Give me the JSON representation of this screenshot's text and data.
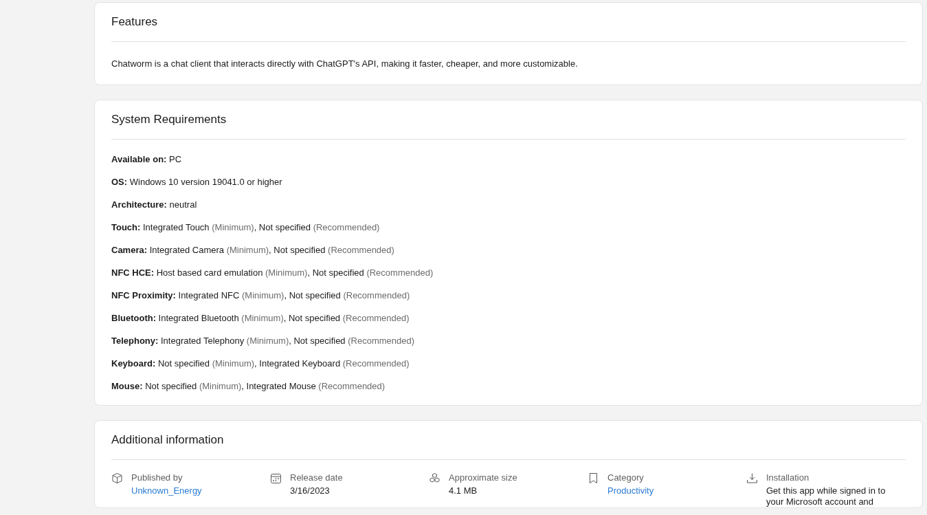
{
  "features": {
    "title": "Features",
    "description": "Chatworm is a chat client that interacts directly with ChatGPT's API, making it faster, cheaper, and more customizable."
  },
  "system_requirements": {
    "title": "System Requirements",
    "items": [
      {
        "label": "Available on:",
        "parts": [
          {
            "text": "PC",
            "muted": false
          }
        ]
      },
      {
        "label": "OS:",
        "parts": [
          {
            "text": "Windows 10 version 19041.0 or higher",
            "muted": false
          }
        ]
      },
      {
        "label": "Architecture:",
        "parts": [
          {
            "text": "neutral",
            "muted": false
          }
        ]
      },
      {
        "label": "Touch:",
        "parts": [
          {
            "text": "Integrated Touch",
            "muted": false
          },
          {
            "text": "(Minimum)",
            "muted": true
          },
          {
            "text": ", Not specified",
            "muted": false
          },
          {
            "text": "(Recommended)",
            "muted": true
          }
        ]
      },
      {
        "label": "Camera:",
        "parts": [
          {
            "text": "Integrated Camera",
            "muted": false
          },
          {
            "text": "(Minimum)",
            "muted": true
          },
          {
            "text": ", Not specified",
            "muted": false
          },
          {
            "text": "(Recommended)",
            "muted": true
          }
        ]
      },
      {
        "label": "NFC HCE:",
        "parts": [
          {
            "text": "Host based card emulation",
            "muted": false
          },
          {
            "text": "(Minimum)",
            "muted": true
          },
          {
            "text": ", Not specified",
            "muted": false
          },
          {
            "text": "(Recommended)",
            "muted": true
          }
        ]
      },
      {
        "label": "NFC Proximity:",
        "parts": [
          {
            "text": "Integrated NFC",
            "muted": false
          },
          {
            "text": "(Minimum)",
            "muted": true
          },
          {
            "text": ", Not specified",
            "muted": false
          },
          {
            "text": "(Recommended)",
            "muted": true
          }
        ]
      },
      {
        "label": "Bluetooth:",
        "parts": [
          {
            "text": "Integrated Bluetooth",
            "muted": false
          },
          {
            "text": "(Minimum)",
            "muted": true
          },
          {
            "text": ", Not specified",
            "muted": false
          },
          {
            "text": "(Recommended)",
            "muted": true
          }
        ]
      },
      {
        "label": "Telephony:",
        "parts": [
          {
            "text": "Integrated Telephony",
            "muted": false
          },
          {
            "text": "(Minimum)",
            "muted": true
          },
          {
            "text": ", Not specified",
            "muted": false
          },
          {
            "text": "(Recommended)",
            "muted": true
          }
        ]
      },
      {
        "label": "Keyboard:",
        "parts": [
          {
            "text": "Not specified",
            "muted": false
          },
          {
            "text": "(Minimum)",
            "muted": true
          },
          {
            "text": ", Integrated Keyboard",
            "muted": false
          },
          {
            "text": "(Recommended)",
            "muted": true
          }
        ]
      },
      {
        "label": "Mouse:",
        "parts": [
          {
            "text": "Not specified",
            "muted": false
          },
          {
            "text": "(Minimum)",
            "muted": true
          },
          {
            "text": ", Integrated Mouse",
            "muted": false
          },
          {
            "text": "(Recommended)",
            "muted": true
          }
        ]
      }
    ]
  },
  "additional_information": {
    "title": "Additional information",
    "items": [
      {
        "kind": "publisher",
        "label": "Published by",
        "value": "Unknown_Energy",
        "link": true
      },
      {
        "kind": "release",
        "label": "Release date",
        "value": "3/16/2023",
        "link": false
      },
      {
        "kind": "size",
        "label": "Approximate size",
        "value": "4.1 MB",
        "link": false
      },
      {
        "kind": "category",
        "label": "Category",
        "value": "Productivity",
        "link": true
      },
      {
        "kind": "installation",
        "label": "Installation",
        "value": "Get this app while signed in to your Microsoft account and",
        "link": false
      }
    ]
  }
}
